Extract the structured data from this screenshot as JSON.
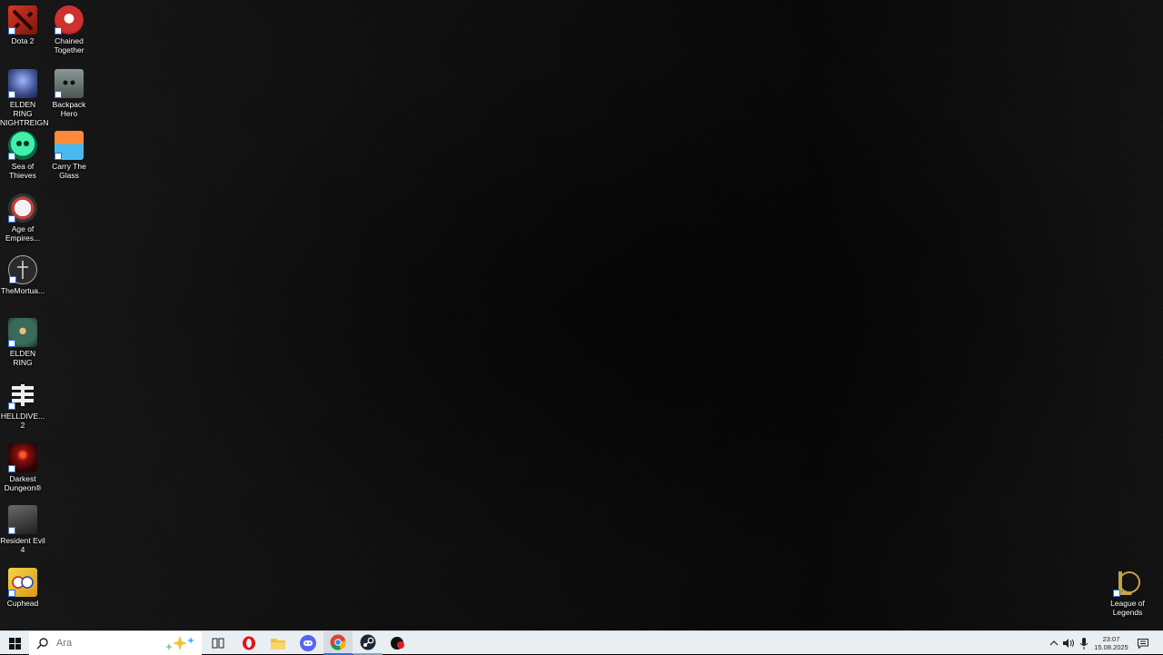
{
  "desktop": {
    "icons_left": [
      {
        "label": "Dota 2",
        "icon": "dota2-icon",
        "color": "#b52a1c"
      },
      {
        "label": "ELDEN RING NIGHTREIGN",
        "icon": "elden-ring-nightreign-icon",
        "color": "#5a6fb8"
      },
      {
        "label": "Sea of Thieves",
        "icon": "sea-of-thieves-icon",
        "color": "#1fd088"
      },
      {
        "label": "Age of Empires...",
        "icon": "age-of-empires-icon",
        "color": "#c04040"
      },
      {
        "label": "TheMortua...",
        "icon": "the-mortuary-icon",
        "color": "#3a3a3a"
      },
      {
        "label": "ELDEN RING",
        "icon": "elden-ring-icon",
        "color": "#2f5f4f"
      },
      {
        "label": "HELLDIVE... 2",
        "icon": "helldivers-2-icon",
        "color": "#eeeeee"
      },
      {
        "label": "Darkest Dungeon®",
        "icon": "darkest-dungeon-icon",
        "color": "#8a1010"
      },
      {
        "label": "Resident Evil 4",
        "icon": "resident-evil-4-icon",
        "color": "#4a4a4a"
      },
      {
        "label": "Cuphead",
        "icon": "cuphead-icon",
        "color": "#e8c030"
      }
    ],
    "icons_right_col": [
      {
        "label": "Chained Together",
        "icon": "chained-together-icon",
        "color": "#c03030"
      },
      {
        "label": "Backpack Hero",
        "icon": "backpack-hero-icon",
        "color": "#6c7a78"
      },
      {
        "label": "Carry The Glass",
        "icon": "carry-the-glass-icon",
        "color": "#3aa0e0"
      }
    ],
    "icon_league": {
      "label": "League of Legends",
      "icon": "league-of-legends-icon",
      "color": "#c8a24a"
    }
  },
  "taskbar": {
    "start_icon": "windows-start-icon",
    "search_placeholder": "Ara",
    "search_icon": "search-icon",
    "highlight_icon": "search-highlight-icon",
    "pinned": [
      {
        "name": "task-view-icon"
      },
      {
        "name": "opera-icon"
      },
      {
        "name": "file-explorer-icon"
      },
      {
        "name": "discord-icon"
      },
      {
        "name": "chrome-icon"
      },
      {
        "name": "steam-icon"
      },
      {
        "name": "app-red-icon"
      }
    ],
    "tray": {
      "chevron_icon": "chevron-up-icon",
      "volume_icon": "volume-icon",
      "mic_icon": "microphone-icon",
      "time": "23:07",
      "date": "15.08.2025",
      "notification_icon": "notification-icon"
    }
  }
}
